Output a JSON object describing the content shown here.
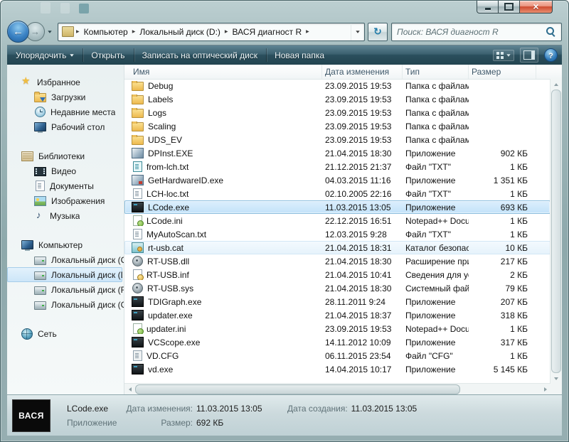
{
  "navbar": {
    "breadcrumb_items": [
      "Компьютер",
      "Локальный диск (D:)",
      "ВАСЯ диагност R"
    ],
    "search_text": "Поиск: ВАСЯ диагност R"
  },
  "toolbar": {
    "organize_label": "Упорядочить",
    "buttons": [
      "Открыть",
      "Записать на оптический диск",
      "Новая папка"
    ]
  },
  "sidebar": {
    "groups": [
      {
        "label": "Избранное",
        "icon": "favorites",
        "items": [
          {
            "label": "Загрузки",
            "icon": "downloads"
          },
          {
            "label": "Недавние места",
            "icon": "recent"
          },
          {
            "label": "Рабочий стол",
            "icon": "desktop"
          }
        ]
      },
      {
        "label": "Библиотеки",
        "icon": "libraries",
        "items": [
          {
            "label": "Видео",
            "icon": "video"
          },
          {
            "label": "Документы",
            "icon": "documents"
          },
          {
            "label": "Изображения",
            "icon": "pictures"
          },
          {
            "label": "Музыка",
            "icon": "music"
          }
        ]
      },
      {
        "label": "Компьютер",
        "icon": "computer",
        "items": [
          {
            "label": "Локальный диск (C",
            "icon": "drive"
          },
          {
            "label": "Локальный диск (D",
            "icon": "drive",
            "selected": true
          },
          {
            "label": "Локальный диск (F:",
            "icon": "drive"
          },
          {
            "label": "Локальный диск (G",
            "icon": "drive"
          }
        ]
      },
      {
        "label": "Сеть",
        "icon": "network",
        "items": []
      }
    ]
  },
  "filelist": {
    "columns": [
      "Имя",
      "Дата изменения",
      "Тип",
      "Размер"
    ],
    "rows": [
      {
        "name": "Debug",
        "icon": "folder",
        "modified": "23.09.2015 19:53",
        "type": "Папка с файлами",
        "size": ""
      },
      {
        "name": "Labels",
        "icon": "folder",
        "modified": "23.09.2015 19:53",
        "type": "Папка с файлами",
        "size": ""
      },
      {
        "name": "Logs",
        "icon": "folder",
        "modified": "23.09.2015 19:53",
        "type": "Папка с файлами",
        "size": ""
      },
      {
        "name": "Scaling",
        "icon": "folder",
        "modified": "23.09.2015 19:53",
        "type": "Папка с файлами",
        "size": ""
      },
      {
        "name": "UDS_EV",
        "icon": "folder",
        "modified": "23.09.2015 19:53",
        "type": "Папка с файлами",
        "size": ""
      },
      {
        "name": "DPInst.EXE",
        "icon": "app",
        "modified": "21.04.2015 18:30",
        "type": "Приложение",
        "size": "902 КБ"
      },
      {
        "name": "from-lch.txt",
        "icon": "txt-teal",
        "modified": "21.12.2015 21:37",
        "type": "Файл \"TXT\"",
        "size": "1 КБ"
      },
      {
        "name": "GetHardwareID.exe",
        "icon": "app-red",
        "modified": "04.03.2015 11:16",
        "type": "Приложение",
        "size": "1 351 КБ"
      },
      {
        "name": "LCH-loc.txt",
        "icon": "txt",
        "modified": "02.10.2005 22:16",
        "type": "Файл \"TXT\"",
        "size": "1 КБ"
      },
      {
        "name": "LCode.exe",
        "icon": "app-dark",
        "modified": "11.03.2015 13:05",
        "type": "Приложение",
        "size": "693 КБ",
        "selected": true
      },
      {
        "name": "LCode.ini",
        "icon": "npp",
        "modified": "22.12.2015 16:51",
        "type": "Notepad++ Docu...",
        "size": "1 КБ"
      },
      {
        "name": "MyAutoScan.txt",
        "icon": "txt",
        "modified": "12.03.2015 9:28",
        "type": "Файл \"TXT\"",
        "size": "1 КБ"
      },
      {
        "name": "rt-usb.cat",
        "icon": "cat",
        "modified": "21.04.2015 18:31",
        "type": "Каталог безопасн...",
        "size": "10 КБ",
        "hover": true
      },
      {
        "name": "RT-USB.dll",
        "icon": "dll",
        "modified": "21.04.2015 18:30",
        "type": "Расширение при...",
        "size": "217 КБ"
      },
      {
        "name": "RT-USB.inf",
        "icon": "inf",
        "modified": "21.04.2015 10:41",
        "type": "Сведения для уст...",
        "size": "2 КБ"
      },
      {
        "name": "RT-USB.sys",
        "icon": "sys",
        "modified": "21.04.2015 18:30",
        "type": "Системный файл",
        "size": "79 КБ"
      },
      {
        "name": "TDIGraph.exe",
        "icon": "app-dark",
        "modified": "28.11.2011 9:24",
        "type": "Приложение",
        "size": "207 КБ"
      },
      {
        "name": "updater.exe",
        "icon": "app-dark",
        "modified": "21.04.2015 18:37",
        "type": "Приложение",
        "size": "318 КБ"
      },
      {
        "name": "updater.ini",
        "icon": "npp",
        "modified": "23.09.2015 19:53",
        "type": "Notepad++ Docu...",
        "size": "1 КБ"
      },
      {
        "name": "VCScope.exe",
        "icon": "app-dark",
        "modified": "14.11.2012 10:09",
        "type": "Приложение",
        "size": "317 КБ"
      },
      {
        "name": "VD.CFG",
        "icon": "cfg",
        "modified": "06.11.2015 23:54",
        "type": "Файл \"CFG\"",
        "size": "1 КБ"
      },
      {
        "name": "vd.exe",
        "icon": "app-dark",
        "modified": "14.04.2015 10:17",
        "type": "Приложение",
        "size": "5 145 КБ"
      }
    ]
  },
  "details": {
    "logo_text": "ВАСЯ",
    "file_name": "LCode.exe",
    "file_type": "Приложение",
    "modified_label": "Дата изменения:",
    "modified_value": "11.03.2015 13:05",
    "created_label": "Дата создания:",
    "created_value": "11.03.2015 13:05",
    "size_label": "Размер:",
    "size_value": "692 КБ"
  }
}
